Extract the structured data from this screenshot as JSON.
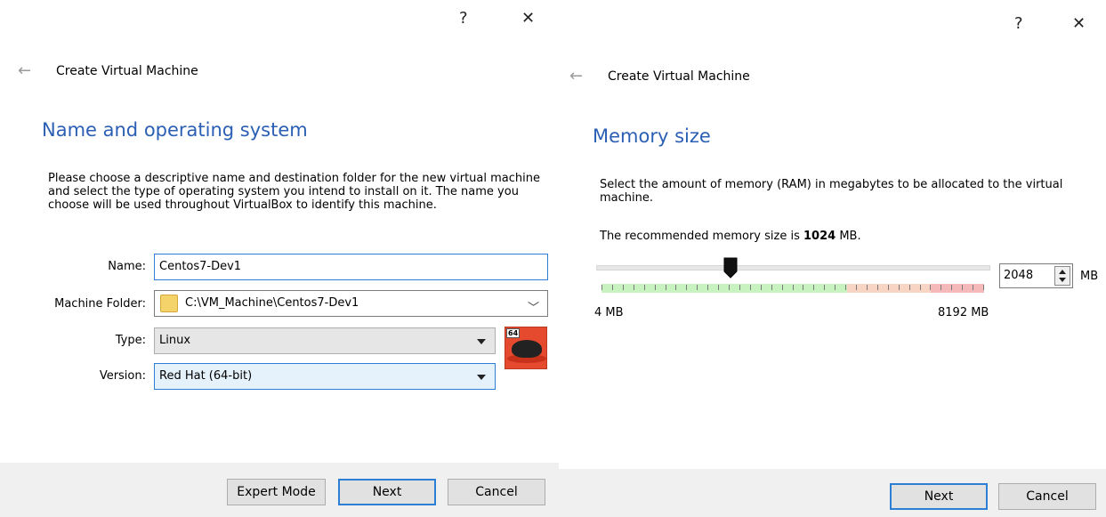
{
  "left": {
    "help_glyph": "?",
    "close_glyph": "✕",
    "back_glyph": "←",
    "title": "Create Virtual Machine",
    "heading": "Name and operating system",
    "description": "Please choose a descriptive name and destination folder for the new virtual machine and select the type of operating system you intend to install on it. The name you choose will be used throughout VirtualBox to identify this machine.",
    "name_label": "Name:",
    "name_value": "Centos7-Dev1",
    "folder_label": "Machine Folder:",
    "folder_value": "C:\\VM_Machine\\Centos7-Dev1",
    "type_label": "Type:",
    "type_value": "Linux",
    "version_label": "Version:",
    "version_value": "Red Hat (64-bit)",
    "os_badge": "64",
    "os_icon": "red-hat-icon",
    "buttons": {
      "expert": "Expert Mode",
      "next": "Next",
      "cancel": "Cancel"
    }
  },
  "right": {
    "help_glyph": "?",
    "close_glyph": "✕",
    "back_glyph": "←",
    "title": "Create Virtual Machine",
    "heading": "Memory size",
    "description": "Select the amount of memory (RAM) in megabytes to be allocated to the virtual machine.",
    "recommended_prefix": "The recommended memory size is",
    "recommended_value": "1024",
    "recommended_suffix": "MB.",
    "slider": {
      "min": 4,
      "max": 8192,
      "value": 2048
    },
    "memory_value": "2048",
    "unit": "MB",
    "min_label": "4 MB",
    "max_label": "8192 MB",
    "buttons": {
      "next": "Next",
      "cancel": "Cancel"
    }
  },
  "colors": {
    "heading": "#2b5fb4",
    "focus": "#2d7fd6",
    "zone_green": "#c9f2c1",
    "zone_orange": "#f8d4c4",
    "zone_red": "#f6b9b9"
  }
}
